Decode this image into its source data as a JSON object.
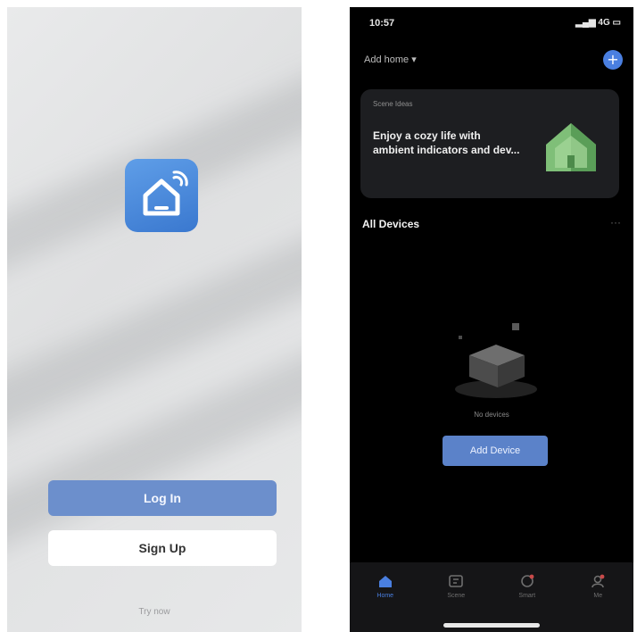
{
  "left_screen": {
    "login_label": "Log In",
    "signup_label": "Sign Up",
    "try_label": "Try now"
  },
  "right_screen": {
    "status_time": "10:57",
    "status_right": "4G",
    "home_title": "Add home",
    "card": {
      "label": "Scene Ideas",
      "text": "Enjoy a cozy life with ambient indicators and dev..."
    },
    "section_title": "All Devices",
    "more": "···",
    "empty_text": "No devices",
    "add_device_label": "Add Device",
    "tabs": [
      {
        "label": "Home",
        "icon": "home-icon",
        "active": true
      },
      {
        "label": "Scene",
        "icon": "scene-icon",
        "active": false
      },
      {
        "label": "Smart",
        "icon": "smart-icon",
        "active": false
      },
      {
        "label": "Me",
        "icon": "me-icon",
        "active": false
      }
    ]
  },
  "colors": {
    "accent": "#4a7fe0",
    "login_button": "#6c8fcc",
    "dark_bg": "#000000",
    "card_bg": "#1d1e21"
  }
}
